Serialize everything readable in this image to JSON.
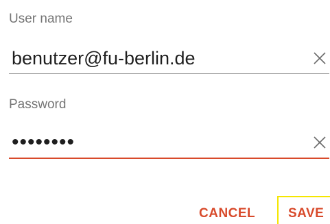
{
  "username": {
    "label": "User name",
    "value": "benutzer@fu-berlin.de"
  },
  "password": {
    "label": "Password",
    "value": "••••••••"
  },
  "actions": {
    "cancel_label": "CANCEL",
    "save_label": "SAVE"
  },
  "icons": {
    "clear": "close-icon"
  },
  "colors": {
    "accent": "#d84a2b",
    "label": "#757575",
    "text": "#1f1f1f",
    "underline": "#9e9e9e",
    "focus_highlight": "#f5e600"
  }
}
